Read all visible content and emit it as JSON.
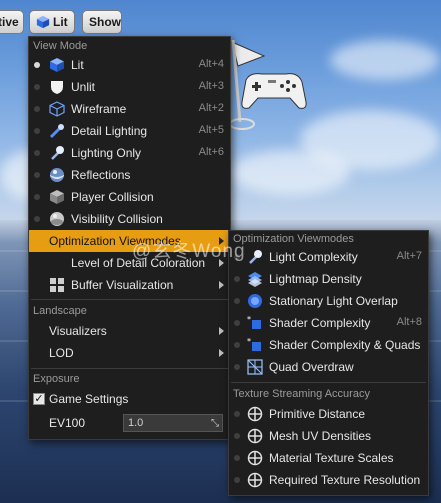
{
  "toolbar": {
    "perspective_label": "tive",
    "lit_label": "Lit",
    "show_label": "Show"
  },
  "view_mode": {
    "header": "View Mode",
    "items": [
      {
        "label": "Lit",
        "shortcut": "Alt+4",
        "icon": "lit-cube-icon",
        "selected": true
      },
      {
        "label": "Unlit",
        "shortcut": "Alt+3",
        "icon": "unlit-shield-icon"
      },
      {
        "label": "Wireframe",
        "shortcut": "Alt+2",
        "icon": "wireframe-cube-icon"
      },
      {
        "label": "Detail Lighting",
        "shortcut": "Alt+5",
        "icon": "detail-lighting-icon"
      },
      {
        "label": "Lighting Only",
        "shortcut": "Alt+6",
        "icon": "lighting-only-icon"
      },
      {
        "label": "Reflections",
        "shortcut": "",
        "icon": "reflections-sphere-icon"
      },
      {
        "label": "Player Collision",
        "shortcut": "",
        "icon": "player-collision-icon"
      },
      {
        "label": "Visibility Collision",
        "shortcut": "",
        "icon": "visibility-collision-icon"
      }
    ],
    "submenus": [
      {
        "label": "Optimization Viewmodes",
        "highlighted": true
      },
      {
        "label": "Level of Detail Coloration"
      },
      {
        "label": "Buffer Visualization",
        "icon": "buffer-grid-icon"
      }
    ]
  },
  "landscape": {
    "header": "Landscape",
    "items": [
      {
        "label": "Visualizers"
      },
      {
        "label": "LOD"
      }
    ]
  },
  "exposure": {
    "header": "Exposure",
    "game_settings_label": "Game Settings",
    "game_settings_checked": true,
    "ev100_label": "EV100",
    "ev100_value": "1.0"
  },
  "optimization": {
    "header": "Optimization Viewmodes",
    "items": [
      {
        "label": "Light Complexity",
        "shortcut": "Alt+7",
        "icon": "light-complexity-icon"
      },
      {
        "label": "Lightmap Density",
        "shortcut": "",
        "icon": "lightmap-density-icon"
      },
      {
        "label": "Stationary Light Overlap",
        "shortcut": "",
        "icon": "stationary-light-icon"
      },
      {
        "label": "Shader Complexity",
        "shortcut": "Alt+8",
        "icon": "shader-complexity-icon"
      },
      {
        "label": "Shader Complexity & Quads",
        "shortcut": "",
        "icon": "shader-quads-icon"
      },
      {
        "label": "Quad Overdraw",
        "shortcut": "",
        "icon": "quad-overdraw-icon"
      }
    ],
    "texture_header": "Texture Streaming Accuracy",
    "texture_items": [
      {
        "label": "Primitive Distance",
        "icon": "crosshair-icon"
      },
      {
        "label": "Mesh UV Densities",
        "icon": "crosshair-icon"
      },
      {
        "label": "Material Texture Scales",
        "icon": "crosshair-icon"
      },
      {
        "label": "Required Texture Resolution",
        "icon": "crosshair-icon"
      }
    ]
  },
  "watermark": "@玄冬Wong",
  "colors": {
    "menu_bg": "#1e1e1e",
    "highlight": "#e79d12",
    "text": "#e6e6e6",
    "section_text": "#9a9a9a"
  }
}
